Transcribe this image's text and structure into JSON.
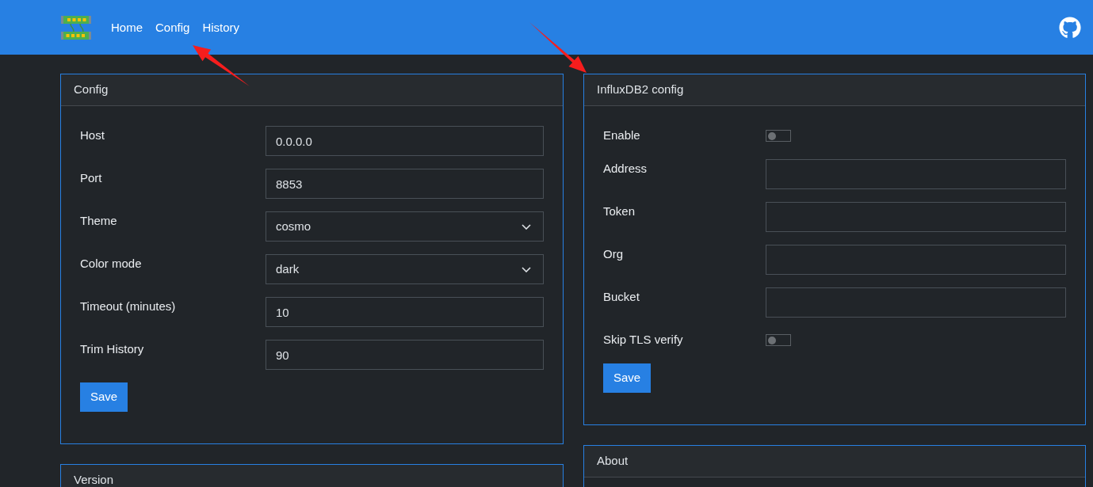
{
  "navbar": {
    "links": [
      "Home",
      "Config",
      "History"
    ]
  },
  "config_card": {
    "title": "Config",
    "fields": [
      {
        "kind": "text",
        "label": "Host",
        "value": "0.0.0.0"
      },
      {
        "kind": "text",
        "label": "Port",
        "value": "8853"
      },
      {
        "kind": "select",
        "label": "Theme",
        "value": "cosmo"
      },
      {
        "kind": "select",
        "label": "Color mode",
        "value": "dark"
      },
      {
        "kind": "text",
        "label": "Timeout (minutes)",
        "value": "10"
      },
      {
        "kind": "text",
        "label": "Trim History",
        "value": "90"
      }
    ],
    "button": "Save"
  },
  "version_card": {
    "title": "Version"
  },
  "influx_card": {
    "title": "InfluxDB2 config",
    "fields": [
      {
        "kind": "switch",
        "label": "Enable",
        "on": false
      },
      {
        "kind": "text",
        "label": "Address"
      },
      {
        "kind": "text",
        "label": "Token"
      },
      {
        "kind": "text",
        "label": "Org"
      },
      {
        "kind": "text",
        "label": "Bucket"
      },
      {
        "kind": "switch",
        "label": "Skip TLS verify",
        "on": false
      }
    ],
    "button": "Save"
  },
  "about_card": {
    "title": "About"
  }
}
